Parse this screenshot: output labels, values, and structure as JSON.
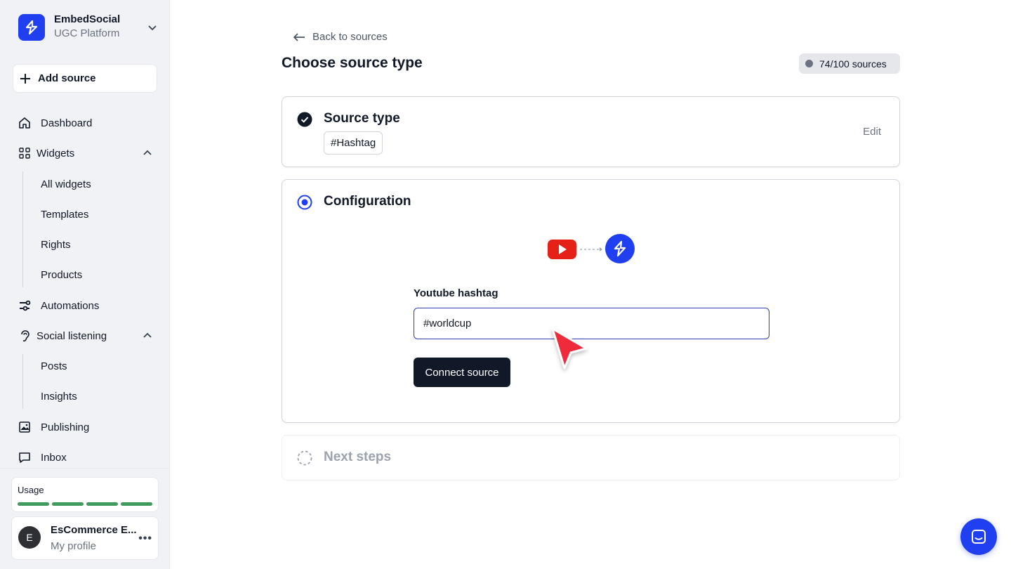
{
  "brand": {
    "name": "EmbedSocial",
    "subtitle": "UGC Platform"
  },
  "sidebar": {
    "add_source": "Add source",
    "items": [
      {
        "label": "Dashboard",
        "icon": "home-icon"
      },
      {
        "label": "Widgets",
        "icon": "grid-icon",
        "expanded": true,
        "children": [
          "All widgets",
          "Templates",
          "Rights",
          "Products"
        ]
      },
      {
        "label": "Automations",
        "icon": "automations-icon"
      },
      {
        "label": "Social listening",
        "icon": "ear-icon",
        "expanded": true,
        "children": [
          "Posts",
          "Insights"
        ]
      },
      {
        "label": "Publishing",
        "icon": "image-icon"
      },
      {
        "label": "Inbox",
        "icon": "chat-bubble-icon"
      }
    ],
    "usage": {
      "label": "Usage",
      "segments": 4,
      "color": "#3f9a5d"
    },
    "profile": {
      "initial": "E",
      "name": "EsCommerce E...",
      "subtitle": "My profile",
      "more": "•••"
    }
  },
  "header": {
    "back_label": "Back to sources",
    "title": "Choose source type",
    "quota": "74/100 sources"
  },
  "steps": {
    "source_type": {
      "title": "Source type",
      "value": "#Hashtag",
      "edit": "Edit",
      "status": "completed"
    },
    "configuration": {
      "title": "Configuration",
      "status": "active",
      "field_label": "Youtube hashtag",
      "field_value": "#worldcup",
      "connect_label": "Connect source",
      "flow_from": "youtube-icon",
      "flow_to": "embedsocial-logo-icon"
    },
    "next_steps": {
      "title": "Next steps",
      "status": "pending"
    }
  },
  "colors": {
    "accent": "#1f3ff0",
    "dark": "#111827",
    "cursor": "#ef2b3b",
    "youtube": "#e62117"
  }
}
